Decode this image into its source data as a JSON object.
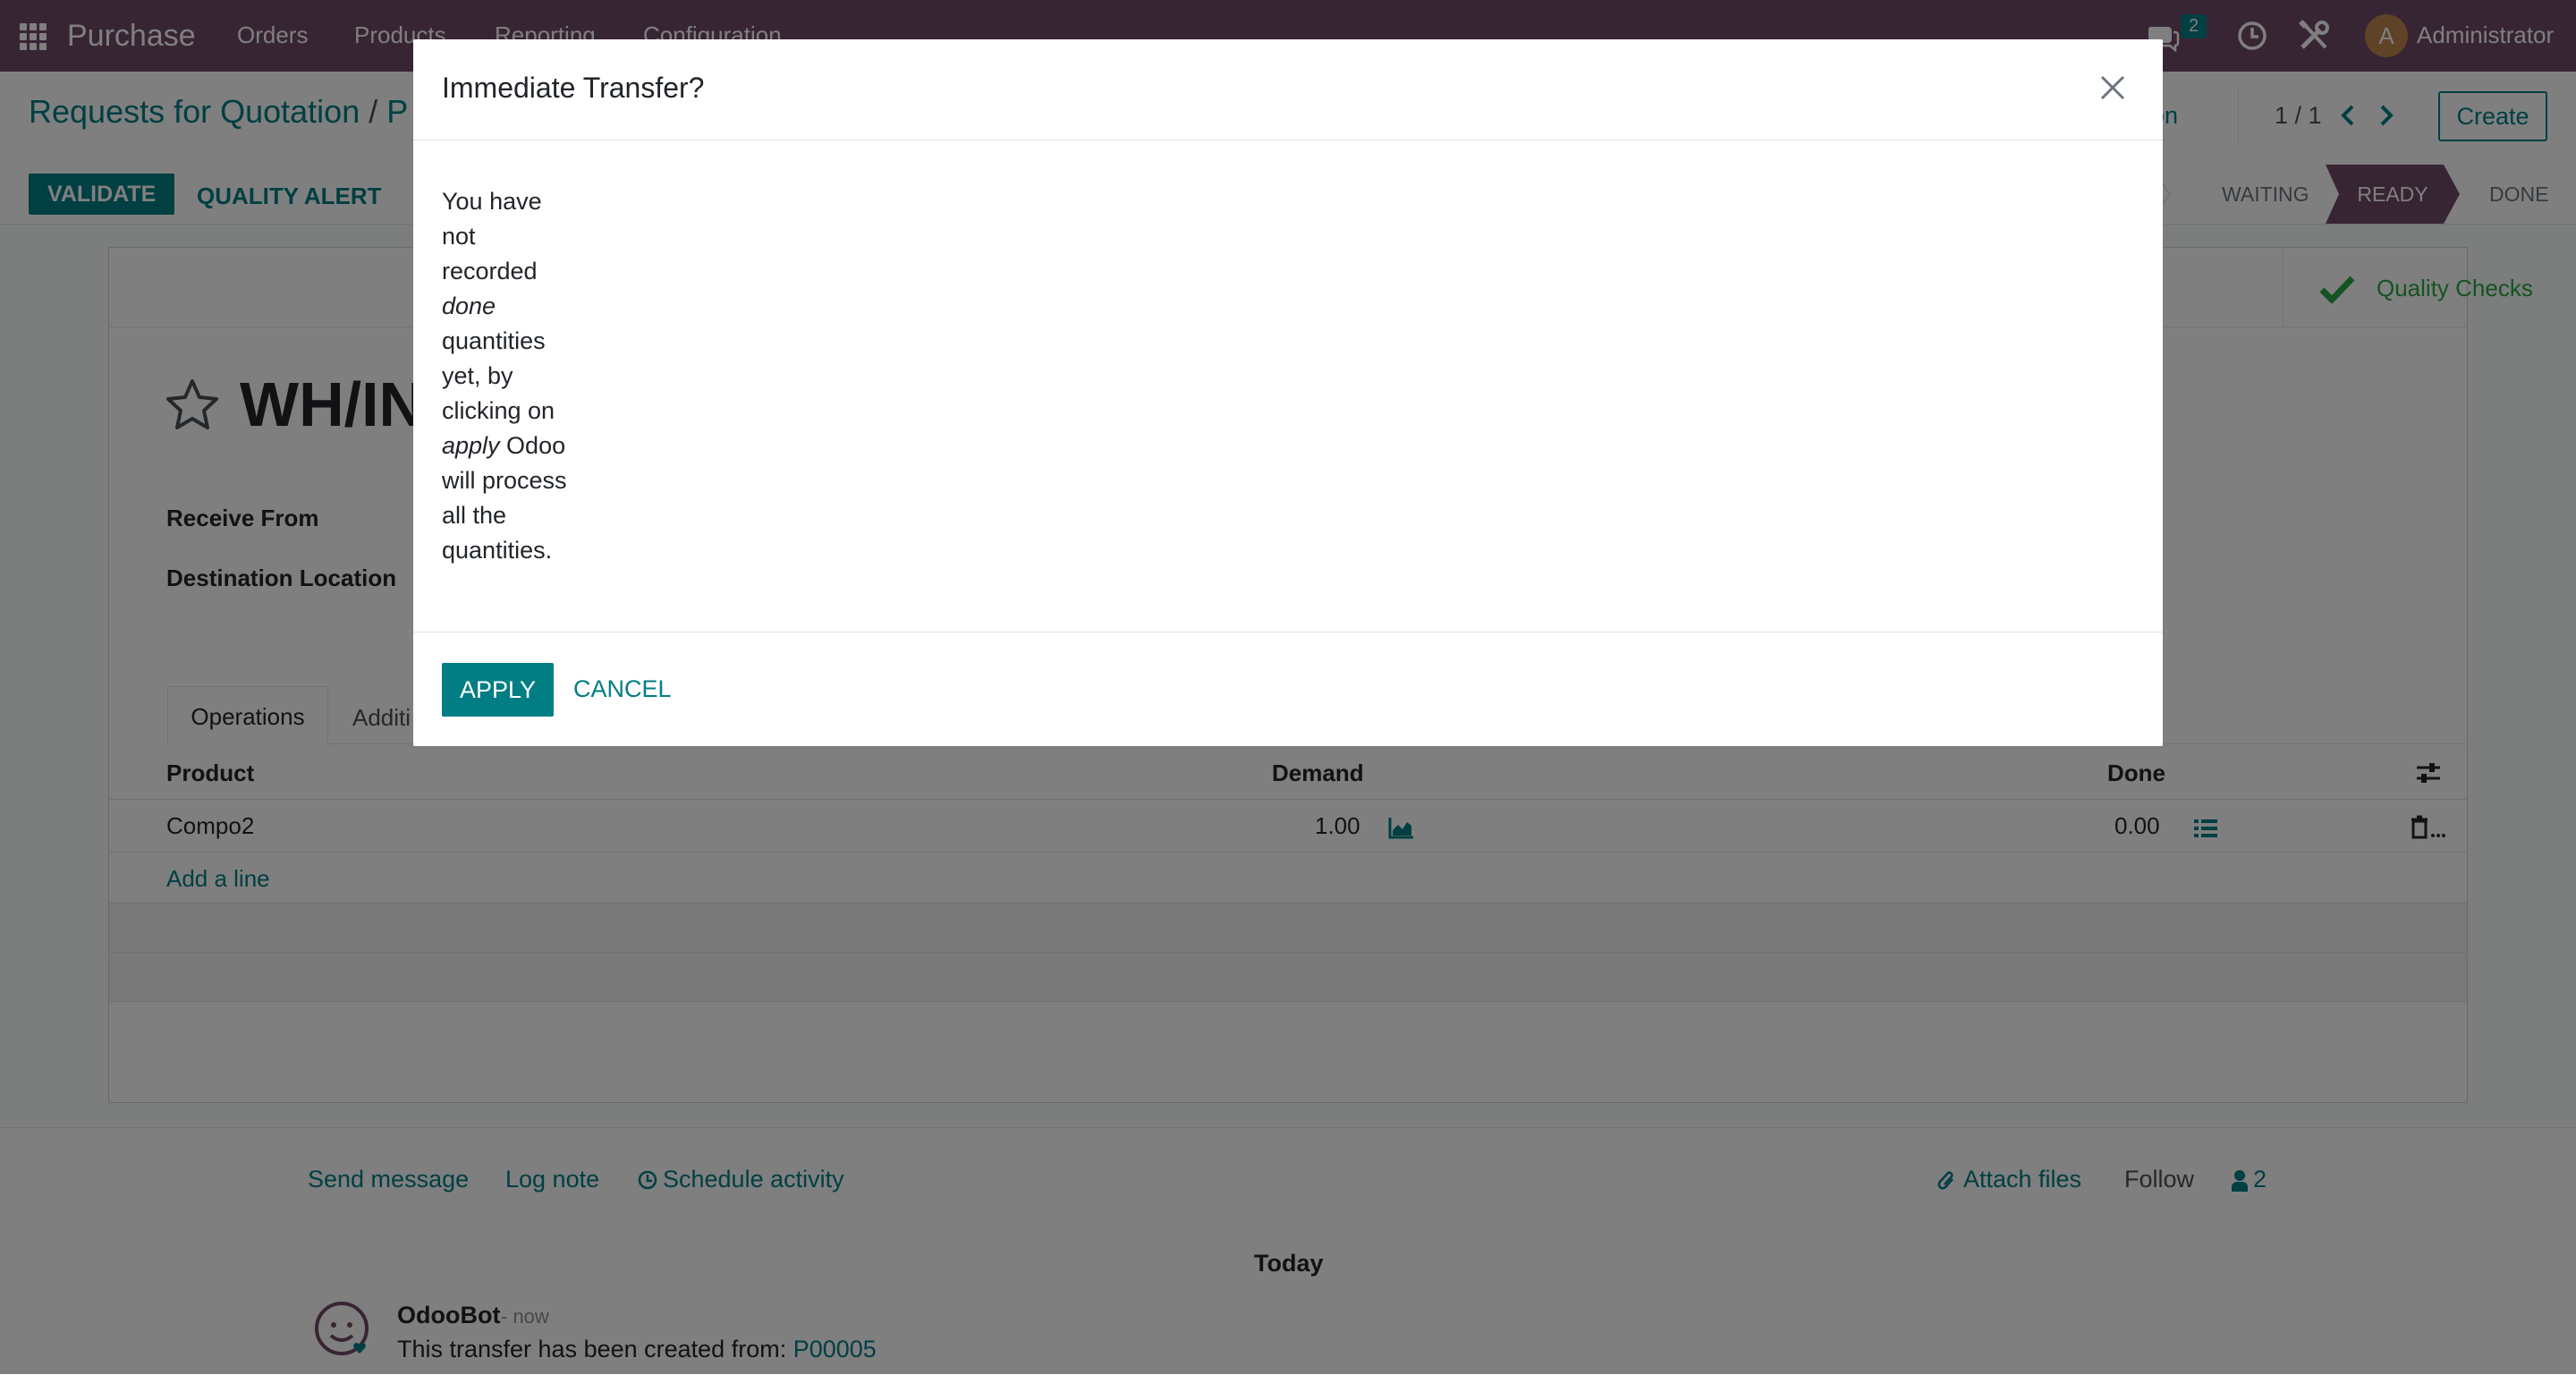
{
  "navbar": {
    "app_name": "Purchase",
    "menu": [
      "Orders",
      "Products",
      "Reporting",
      "Configuration"
    ],
    "messages_count": "2",
    "user_initial": "A",
    "user_name": "Administrator"
  },
  "control_panel": {
    "breadcrumb_root": "Requests for Quotation",
    "breadcrumb_sep": "/",
    "breadcrumb_current": "P",
    "action_label": "ction",
    "pager": "1 / 1",
    "create_label": "Create"
  },
  "statusbar": {
    "validate_label": "VALIDATE",
    "quality_alert_label": "QUALITY ALERT",
    "stages": [
      "WAITING",
      "READY",
      "DONE"
    ],
    "active_stage": "READY"
  },
  "sheet": {
    "quality_checks_label": "Quality Checks",
    "title": "WH/IN/",
    "fields": {
      "receive_from_label": "Receive From",
      "destination_label": "Destination Location"
    },
    "tabs": [
      "Operations",
      "Additi"
    ],
    "table": {
      "headers": {
        "product": "Product",
        "demand": "Demand",
        "done": "Done"
      },
      "rows": [
        {
          "product": "Compo2",
          "demand": "1.00",
          "done": "0.00"
        }
      ],
      "add_line": "Add a line"
    }
  },
  "chatter": {
    "send_message": "Send message",
    "log_note": "Log note",
    "schedule_activity": "Schedule activity",
    "attach_files": "Attach files",
    "follow": "Follow",
    "followers_count": "2",
    "date_separator": "Today",
    "message": {
      "author": "OdooBot",
      "time": "- now",
      "body": "This transfer has been created from:",
      "link": "P00005"
    }
  },
  "dialog": {
    "title": "Immediate Transfer?",
    "body_lines": [
      {
        "text": "You have"
      },
      {
        "text": "not"
      },
      {
        "text": "recorded"
      },
      {
        "text": "done",
        "italic": true
      },
      {
        "text": "quantities"
      },
      {
        "text": "yet, by"
      },
      {
        "text": "clicking on"
      },
      {
        "text": "apply",
        "italic": true,
        "suffix": " Odoo"
      },
      {
        "text": "will process"
      },
      {
        "text": "all the"
      },
      {
        "text": "quantities."
      }
    ],
    "apply_label": "APPLY",
    "cancel_label": "CANCEL"
  },
  "colors": {
    "brand": "#714b67",
    "primary": "#017e84",
    "success": "#28a745"
  }
}
